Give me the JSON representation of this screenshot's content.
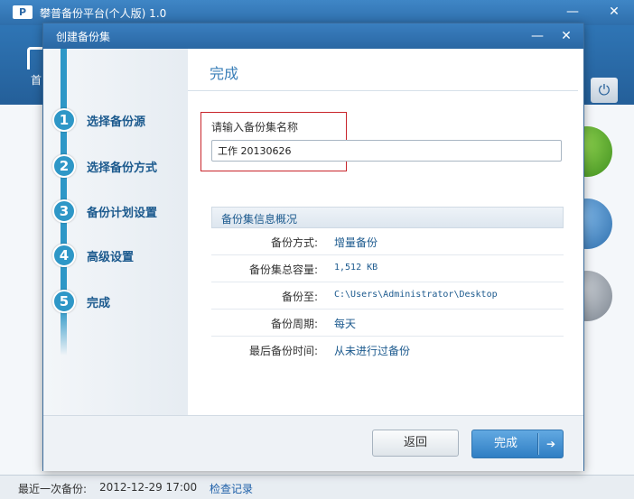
{
  "main_window": {
    "title": "攀普备份平台(个人版) 1.0",
    "logo_text": "P",
    "home_label": "首",
    "power_icon": "⏻",
    "minimize": "—",
    "close": "✕",
    "status": {
      "last_backup_label": "最近一次备份:",
      "last_backup_time": "2012-12-29 17:00",
      "check_log_link": "检查记录"
    }
  },
  "dialog": {
    "title": "创建备份集",
    "minimize": "—",
    "close": "✕",
    "steps": [
      {
        "num": "1",
        "label": "选择备份源"
      },
      {
        "num": "2",
        "label": "选择备份方式"
      },
      {
        "num": "3",
        "label": "备份计划设置"
      },
      {
        "num": "4",
        "label": "高级设置"
      },
      {
        "num": "5",
        "label": "完成"
      }
    ],
    "content_title": "完成",
    "name_label": "请输入备份集名称",
    "name_value": "工作 20130626",
    "info_header": "备份集信息概况",
    "info": [
      {
        "key": "备份方式:",
        "value": "增量备份"
      },
      {
        "key": "备份集总容量:",
        "value": "1,512 KB"
      },
      {
        "key": "备份至:",
        "value": "C:\\Users\\Administrator\\Desktop"
      },
      {
        "key": "备份周期:",
        "value": "每天"
      },
      {
        "key": "最后备份时间:",
        "value": "从未进行过备份"
      }
    ],
    "back_label": "返回",
    "finish_label": "完成",
    "finish_arrow": "➔"
  },
  "colors": {
    "accent": "#2e97c7",
    "title_bar": "#2f75b5",
    "highlight_box": "#c8252b"
  }
}
